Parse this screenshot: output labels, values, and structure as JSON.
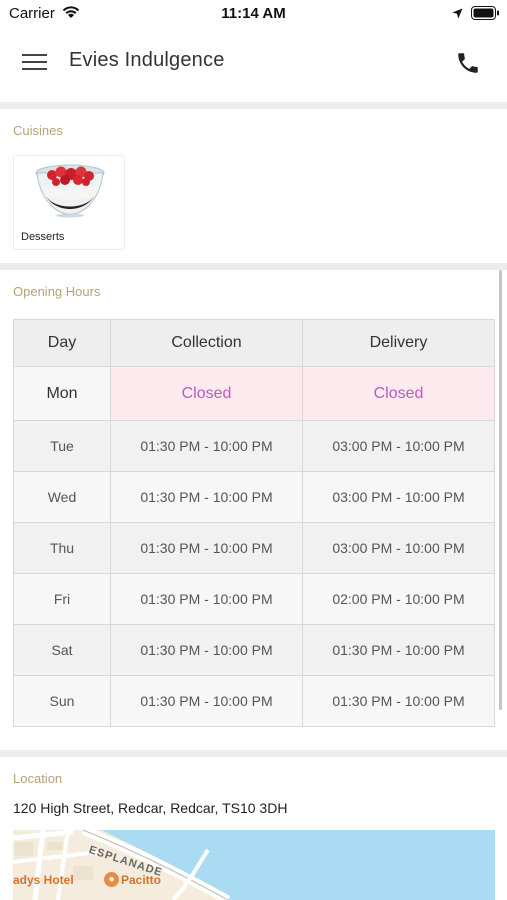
{
  "status_bar": {
    "carrier": "Carrier",
    "time": "11:14 AM"
  },
  "header": {
    "title": "Evies Indulgence"
  },
  "cuisines": {
    "title": "Cuisines",
    "items": [
      {
        "label": "Desserts"
      }
    ]
  },
  "opening_hours": {
    "title": "Opening Hours",
    "columns": [
      "Day",
      "Collection",
      "Delivery"
    ],
    "rows": [
      {
        "day": "Mon",
        "collection": "Closed",
        "delivery": "Closed"
      },
      {
        "day": "Tue",
        "collection": "01:30 PM - 10:00 PM",
        "delivery": "03:00 PM - 10:00 PM"
      },
      {
        "day": "Wed",
        "collection": "01:30 PM - 10:00 PM",
        "delivery": "03:00 PM - 10:00 PM"
      },
      {
        "day": "Thu",
        "collection": "01:30 PM - 10:00 PM",
        "delivery": "03:00 PM - 10:00 PM"
      },
      {
        "day": "Fri",
        "collection": "01:30 PM - 10:00 PM",
        "delivery": "02:00 PM - 10:00 PM"
      },
      {
        "day": "Sat",
        "collection": "01:30 PM - 10:00 PM",
        "delivery": "01:30 PM - 10:00 PM"
      },
      {
        "day": "Sun",
        "collection": "01:30 PM - 10:00 PM",
        "delivery": "01:30 PM - 10:00 PM"
      }
    ]
  },
  "location": {
    "title": "Location",
    "address": "120 High Street, Redcar, Redcar, TS10 3DH",
    "map": {
      "street_label": "ESPLANADE",
      "hotel_label": "adys Hotel",
      "poi_label": "Pacitto"
    }
  },
  "colors": {
    "section_title": "#b9a177",
    "closed_text": "#b95bc4",
    "closed_bg": "#fdeaee",
    "sea": "#a9dbf2",
    "map_land": "#f5ecdd"
  },
  "icons": [
    "wifi-icon",
    "location-arrow-icon",
    "battery-icon",
    "menu-icon",
    "phone-icon"
  ]
}
